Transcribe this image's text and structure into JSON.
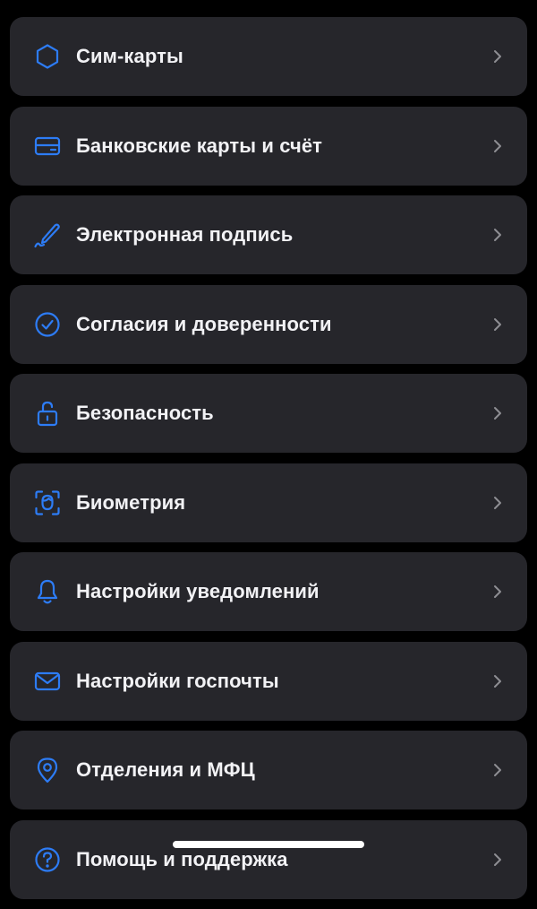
{
  "theme": {
    "accent": "#2d7cf6",
    "card_background": "#26262b",
    "text": "#f2f2f5",
    "chevron": "#8e8e93"
  },
  "menu": {
    "items": [
      {
        "label": "Сим-карты",
        "icon": "sim-card-icon"
      },
      {
        "label": "Банковские карты и счёт",
        "icon": "bank-card-icon"
      },
      {
        "label": "Электронная подпись",
        "icon": "signature-pen-icon"
      },
      {
        "label": "Согласия и доверенности",
        "icon": "check-circle-icon"
      },
      {
        "label": "Безопасность",
        "icon": "unlocked-padlock-icon"
      },
      {
        "label": "Биометрия",
        "icon": "face-scan-icon"
      },
      {
        "label": "Настройки уведомлений",
        "icon": "bell-icon"
      },
      {
        "label": "Настройки госпочты",
        "icon": "envelope-icon"
      },
      {
        "label": "Отделения и МФЦ",
        "icon": "location-pin-icon"
      },
      {
        "label": "Помощь и поддержка",
        "icon": "question-circle-icon"
      }
    ]
  }
}
